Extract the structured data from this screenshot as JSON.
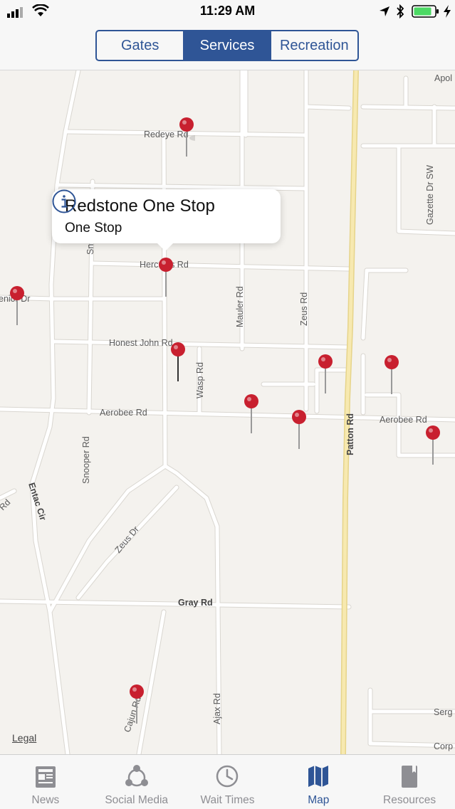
{
  "status_bar": {
    "time": "11:29 AM"
  },
  "segmented_control": {
    "segments": [
      {
        "label": "Gates",
        "active": false
      },
      {
        "label": "Services",
        "active": true
      },
      {
        "label": "Recreation",
        "active": false
      }
    ]
  },
  "map": {
    "road_labels": {
      "redeye_rd": "Redeye Rd",
      "hercules_rd": "Hercules Rd",
      "honest_john_rd": "Honest John Rd",
      "aerobee_rd_west": "Aerobee Rd",
      "aerobee_rd_east": "Aerobee Rd",
      "gray_rd": "Gray Rd",
      "mauler_rd": "Mauler Rd",
      "zeus_rd": "Zeus Rd",
      "wasp_rd": "Wasp Rd",
      "patton_rd": "Patton Rd",
      "snooper_rd": "Snooper Rd",
      "entac_cir": "Entac Cir",
      "zeus_dr": "Zeus Dr",
      "ajax_rd": "Ajax Rd",
      "cajun_rd": "Cajun Rd",
      "gazette_dr_sw": "Gazette Dr SW",
      "apol": "Apol",
      "serg": "Serg",
      "corp": "Corp",
      "senior_dr": "enior Dr",
      "west_rd": "Rd",
      "sn": "Sn"
    },
    "callout": {
      "title": "Redstone One Stop",
      "subtitle": "One Stop"
    },
    "legal": "Legal",
    "pin_color": "#c8202f"
  },
  "tabs": [
    {
      "label": "News",
      "icon": "newspaper-icon",
      "active": false
    },
    {
      "label": "Social Media",
      "icon": "social-network-icon",
      "active": false
    },
    {
      "label": "Wait Times",
      "icon": "clock-icon",
      "active": false
    },
    {
      "label": "Map",
      "icon": "map-icon",
      "active": true
    },
    {
      "label": "Resources",
      "icon": "book-icon",
      "active": false
    }
  ],
  "colors": {
    "accent": "#2f5596",
    "map_background": "#f4f2ee",
    "major_road": "#f2df9c",
    "pin": "#c8202f"
  }
}
